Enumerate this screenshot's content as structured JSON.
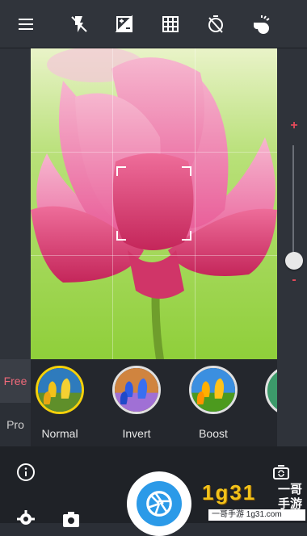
{
  "toolbar": {
    "icons": [
      "menu-icon",
      "flash-off-icon",
      "exposure-icon",
      "grid-icon",
      "timer-off-icon",
      "whistle-icon"
    ]
  },
  "zoom": {
    "plus_label": "+",
    "minus_label": "-",
    "level_fraction": 0.1
  },
  "modes": {
    "free_label": "Free",
    "pro_label": "Pro",
    "active": "Free"
  },
  "filters": [
    {
      "label": "Normal",
      "selected": true
    },
    {
      "label": "Invert",
      "selected": false
    },
    {
      "label": "Boost",
      "selected": false
    }
  ],
  "colors": {
    "accent_red": "#e44a5a",
    "selected_filter_ring": "#f5d10a",
    "shutter_blue": "#2b9ae8"
  },
  "watermark": {
    "brand_text": "1g31",
    "cn_line1": "一哥",
    "cn_line2": "手游",
    "url_text": "一哥手游 1g31.com"
  }
}
